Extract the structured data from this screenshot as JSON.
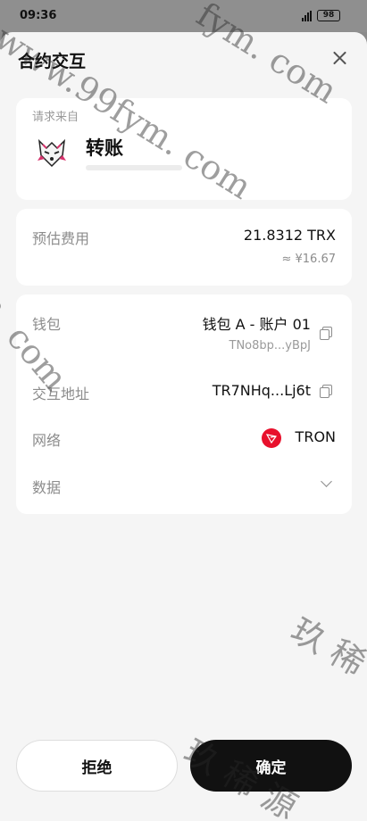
{
  "status_bar": {
    "time": "09:36",
    "battery": "98"
  },
  "sheet": {
    "title": "合约交互"
  },
  "origin": {
    "label": "请求来自",
    "name": "转账"
  },
  "fee": {
    "label": "预估费用",
    "value": "21.8312 TRX",
    "fiat": "≈ ¥16.67"
  },
  "details": {
    "wallet": {
      "label": "钱包",
      "value": "钱包 A - 账户 01",
      "address": "TNo8bp...yBpJ"
    },
    "contract": {
      "label": "交互地址",
      "value": "TR7NHq...Lj6t"
    },
    "network": {
      "label": "网络",
      "value": "TRON"
    },
    "data": {
      "label": "数据"
    }
  },
  "buttons": {
    "reject": "拒绝",
    "confirm": "确定"
  },
  "watermarks": {
    "top_right": "fym. com",
    "diagonal": "www.99fym. com",
    "left": "m. com",
    "bottom_right_1": "玖 稀",
    "bottom_right_2": "玖 稀 源"
  },
  "colors": {
    "sheet": "#f5f5f5",
    "card": "#ffffff",
    "confirm_button": "#111111",
    "tron_red": "#e8102c",
    "muted_text": "#8c8c8c"
  }
}
